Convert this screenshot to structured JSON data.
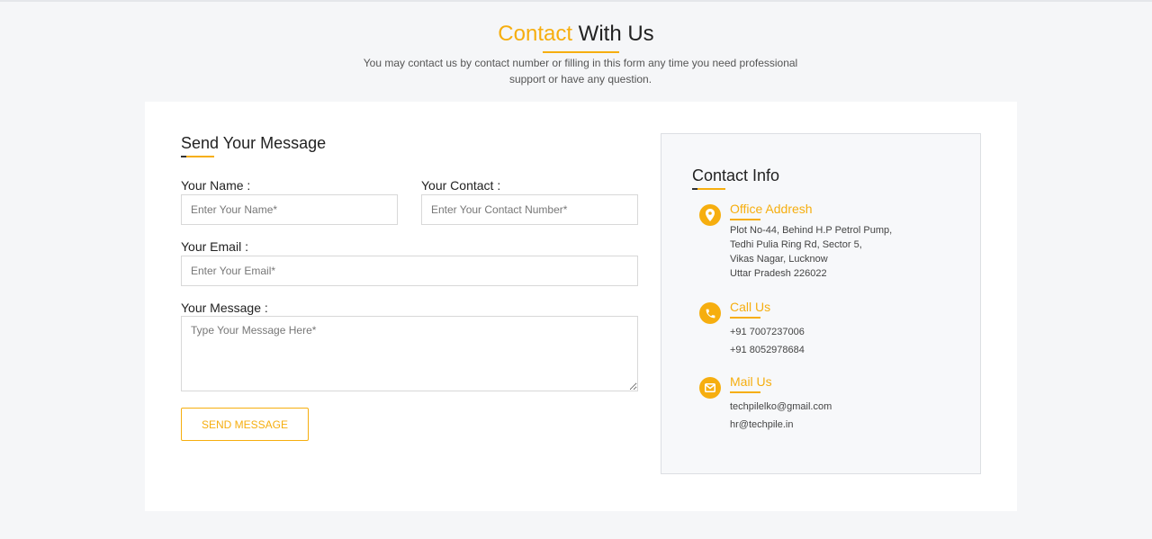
{
  "header": {
    "title_accent": "Contact",
    "title_rest": " With Us",
    "subtitle": "You may contact us by contact number or filling in this form any time you need professional support or have any question."
  },
  "form": {
    "title": "Send Your Message",
    "name_label": "Your Name :",
    "name_placeholder": "Enter Your Name*",
    "contact_label": "Your Contact :",
    "contact_placeholder": "Enter Your Contact Number*",
    "email_label": "Your Email :",
    "email_placeholder": "Enter Your Email*",
    "message_label": "Your Message :",
    "message_placeholder": "Type Your Message Here*",
    "submit_label": "SEND MESSAGE"
  },
  "info": {
    "title": "Contact Info",
    "office": {
      "heading": "Office Addresh",
      "lines": [
        "Plot No-44, Behind H.P Petrol Pump,",
        "Tedhi Pulia Ring Rd, Sector 5,",
        "Vikas Nagar, Lucknow",
        "Uttar Pradesh 226022"
      ],
      "icon": "location-pin-icon"
    },
    "call": {
      "heading": "Call Us",
      "lines": [
        "+91 7007237006",
        "+91 8052978684"
      ],
      "icon": "phone-icon"
    },
    "mail": {
      "heading": "Mail Us",
      "lines": [
        "techpilelko@gmail.com",
        "hr@techpile.in"
      ],
      "icon": "envelope-icon"
    }
  },
  "colors": {
    "accent": "#f6ae0f",
    "background": "#f5f6f8",
    "panel": "#f7f8fa"
  }
}
